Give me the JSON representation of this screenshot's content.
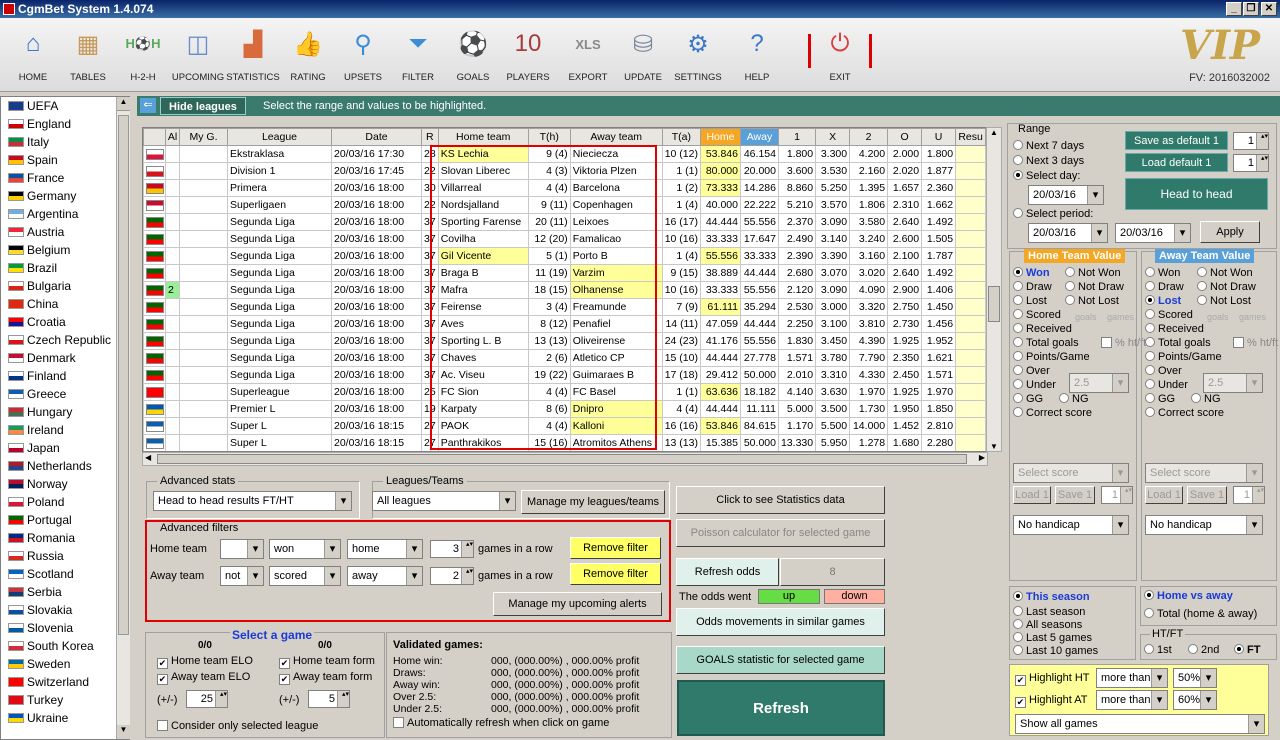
{
  "app": {
    "title": "CgmBet System 1.4.074",
    "vip": "VIP",
    "fv": "FV: 2016032002"
  },
  "toolbar": [
    {
      "label": "HOME",
      "icon": "house-icon",
      "glyph": "⌂",
      "color": "#3c78c8"
    },
    {
      "label": "TABLES",
      "icon": "table-icon",
      "glyph": "▦",
      "color": "#c89a5a"
    },
    {
      "label": "H-2-H",
      "icon": "h2h-icon",
      "glyph": "H⚽H",
      "color": "#5aa85a"
    },
    {
      "label": "UPCOMING",
      "icon": "calendar-icon",
      "glyph": "◫",
      "color": "#6a8cc8"
    },
    {
      "label": "STATISTICS",
      "icon": "chart-icon",
      "glyph": "▟",
      "color": "#d86a3c"
    },
    {
      "label": "RATING",
      "icon": "thumbs-up-icon",
      "glyph": "👍",
      "color": "#3ca83c"
    },
    {
      "label": "UPSETS",
      "icon": "magnifier-icon",
      "glyph": "⚲",
      "color": "#3c8cd8"
    },
    {
      "label": "FILTER",
      "icon": "filter-icon",
      "glyph": "⏷",
      "color": "#3c8cd8"
    },
    {
      "label": "GOALS",
      "icon": "ball-icon",
      "glyph": "⚽",
      "color": "#555555"
    },
    {
      "label": "PLAYERS",
      "icon": "jersey-icon",
      "glyph": "10",
      "color": "#a83c3c"
    },
    {
      "label": "EXPORT",
      "icon": "xls-icon",
      "glyph": "XLS",
      "color": "#888888"
    },
    {
      "label": "UPDATE",
      "icon": "database-icon",
      "glyph": "⛁",
      "color": "#7a8a9a"
    },
    {
      "label": "SETTINGS",
      "icon": "gears-icon",
      "glyph": "⚙",
      "color": "#3c78c8"
    },
    {
      "label": "HELP",
      "icon": "help-icon",
      "glyph": "?",
      "color": "#3c78c8"
    },
    {
      "label": "EXIT",
      "icon": "power-icon",
      "glyph": "⏻",
      "color": "#d83c3c"
    }
  ],
  "countries": [
    {
      "name": "UEFA",
      "c1": "#1a3a8a",
      "c2": "#1a3a8a"
    },
    {
      "name": "England",
      "c1": "#ffffff",
      "c2": "#cc0000"
    },
    {
      "name": "Italy",
      "c1": "#009246",
      "c2": "#ce2b37"
    },
    {
      "name": "Spain",
      "c1": "#c60b1e",
      "c2": "#ffc400"
    },
    {
      "name": "France",
      "c1": "#0055a4",
      "c2": "#ef4135"
    },
    {
      "name": "Germany",
      "c1": "#000000",
      "c2": "#ffce00"
    },
    {
      "name": "Argentina",
      "c1": "#74acdf",
      "c2": "#ffffff"
    },
    {
      "name": "Austria",
      "c1": "#ed2939",
      "c2": "#ffffff"
    },
    {
      "name": "Belgium",
      "c1": "#000000",
      "c2": "#fdda24"
    },
    {
      "name": "Brazil",
      "c1": "#009c3b",
      "c2": "#ffdf00"
    },
    {
      "name": "Bulgaria",
      "c1": "#ffffff",
      "c2": "#d62612"
    },
    {
      "name": "China",
      "c1": "#de2910",
      "c2": "#de2910"
    },
    {
      "name": "Croatia",
      "c1": "#ff0000",
      "c2": "#171796"
    },
    {
      "name": "Czech Republic",
      "c1": "#ffffff",
      "c2": "#d7141a"
    },
    {
      "name": "Denmark",
      "c1": "#c60c30",
      "c2": "#ffffff"
    },
    {
      "name": "Finland",
      "c1": "#ffffff",
      "c2": "#003580"
    },
    {
      "name": "Greece",
      "c1": "#0d5eaf",
      "c2": "#ffffff"
    },
    {
      "name": "Hungary",
      "c1": "#ce2939",
      "c2": "#477050"
    },
    {
      "name": "Ireland",
      "c1": "#169b62",
      "c2": "#ff883e"
    },
    {
      "name": "Japan",
      "c1": "#ffffff",
      "c2": "#bc002d"
    },
    {
      "name": "Netherlands",
      "c1": "#ae1c28",
      "c2": "#21468b"
    },
    {
      "name": "Norway",
      "c1": "#ba0c2f",
      "c2": "#00205b"
    },
    {
      "name": "Poland",
      "c1": "#ffffff",
      "c2": "#dc143c"
    },
    {
      "name": "Portugal",
      "c1": "#006600",
      "c2": "#ff0000"
    },
    {
      "name": "Romania",
      "c1": "#002b7f",
      "c2": "#ce1126"
    },
    {
      "name": "Russia",
      "c1": "#ffffff",
      "c2": "#d52b1e"
    },
    {
      "name": "Scotland",
      "c1": "#0065bd",
      "c2": "#ffffff"
    },
    {
      "name": "Serbia",
      "c1": "#c6363c",
      "c2": "#0c4076"
    },
    {
      "name": "Slovakia",
      "c1": "#ffffff",
      "c2": "#0b4ea2"
    },
    {
      "name": "Slovenia",
      "c1": "#ffffff",
      "c2": "#005da4"
    },
    {
      "name": "South Korea",
      "c1": "#ffffff",
      "c2": "#cd2e3a"
    },
    {
      "name": "Sweden",
      "c1": "#006aa7",
      "c2": "#fecc00"
    },
    {
      "name": "Switzerland",
      "c1": "#ff0000",
      "c2": "#ff0000"
    },
    {
      "name": "Turkey",
      "c1": "#e30a17",
      "c2": "#e30a17"
    },
    {
      "name": "Ukraine",
      "c1": "#0057b7",
      "c2": "#ffd700"
    }
  ],
  "hide_leagues": {
    "button": "Hide leagues",
    "hint": "Select the range and values to be highlighted."
  },
  "grid": {
    "columns": [
      "Al",
      "My G.",
      "League",
      "Date",
      "R",
      "Home team",
      "T(h)",
      "Away team",
      "T(a)",
      "Home",
      "Away",
      "1",
      "X",
      "2",
      "O",
      "U",
      "Resu"
    ],
    "rows": [
      {
        "f1": "#ffffff",
        "f2": "#dc143c",
        "al": "",
        "league": "Ekstraklasa",
        "date": "20/03/16 17:30",
        "r": "28",
        "home": "KS Lechia",
        "hy": true,
        "th": "9 (4)",
        "away": "Nieciecza",
        "ay": false,
        "ta": "10 (12)",
        "hv": "53.846",
        "hvy": true,
        "av": "46.154",
        "o1": "1.800",
        "ox": "3.300",
        "o2": "4.200",
        "oo": "2.000",
        "ou": "1.800"
      },
      {
        "f1": "#ffffff",
        "f2": "#d7141a",
        "al": "",
        "league": "Division 1",
        "date": "20/03/16 17:45",
        "r": "22",
        "home": "Slovan Liberec",
        "hy": false,
        "th": "4 (3)",
        "away": "Viktoria Plzen",
        "ay": false,
        "ta": "1 (1)",
        "hv": "80.000",
        "hvy": true,
        "av": "20.000",
        "o1": "3.600",
        "ox": "3.530",
        "o2": "2.160",
        "oo": "2.020",
        "ou": "1.877"
      },
      {
        "f1": "#c60b1e",
        "f2": "#ffc400",
        "al": "",
        "league": "Primera",
        "date": "20/03/16 18:00",
        "r": "30",
        "home": "Villarreal",
        "hy": false,
        "th": "4 (4)",
        "away": "Barcelona",
        "ay": false,
        "ta": "1 (2)",
        "hv": "73.333",
        "hvy": true,
        "av": "14.286",
        "o1": "8.860",
        "ox": "5.250",
        "o2": "1.395",
        "oo": "1.657",
        "ou": "2.360"
      },
      {
        "f1": "#c60c30",
        "f2": "#ffffff",
        "al": "",
        "league": "Superligaen",
        "date": "20/03/16 18:00",
        "r": "22",
        "home": "Nordsjalland",
        "hy": false,
        "th": "9 (11)",
        "away": "Copenhagen",
        "ay": false,
        "ta": "1 (4)",
        "hv": "40.000",
        "hvy": false,
        "av": "22.222",
        "o1": "5.210",
        "ox": "3.570",
        "o2": "1.806",
        "oo": "2.310",
        "ou": "1.662"
      },
      {
        "f1": "#006600",
        "f2": "#ff0000",
        "al": "",
        "league": "Segunda Liga",
        "date": "20/03/16 18:00",
        "r": "37",
        "home": "Sporting Farense",
        "hy": false,
        "th": "20 (11)",
        "away": "Leixoes",
        "ay": false,
        "ta": "16 (17)",
        "hv": "44.444",
        "hvy": false,
        "av": "55.556",
        "o1": "2.370",
        "ox": "3.090",
        "o2": "3.580",
        "oo": "2.640",
        "ou": "1.492"
      },
      {
        "f1": "#006600",
        "f2": "#ff0000",
        "al": "",
        "league": "Segunda Liga",
        "date": "20/03/16 18:00",
        "r": "37",
        "home": "Covilha",
        "hy": false,
        "th": "12 (20)",
        "away": "Famalicao",
        "ay": false,
        "ta": "10 (16)",
        "hv": "33.333",
        "hvy": false,
        "av": "17.647",
        "o1": "2.490",
        "ox": "3.140",
        "o2": "3.240",
        "oo": "2.600",
        "ou": "1.505"
      },
      {
        "f1": "#006600",
        "f2": "#ff0000",
        "al": "",
        "league": "Segunda Liga",
        "date": "20/03/16 18:00",
        "r": "37",
        "home": "Gil Vicente",
        "hy": true,
        "th": "5 (1)",
        "away": "Porto B",
        "ay": false,
        "ta": "1 (4)",
        "hv": "55.556",
        "hvy": true,
        "av": "33.333",
        "o1": "2.390",
        "ox": "3.390",
        "o2": "3.160",
        "oo": "2.100",
        "ou": "1.787"
      },
      {
        "f1": "#006600",
        "f2": "#ff0000",
        "al": "",
        "league": "Segunda Liga",
        "date": "20/03/16 18:00",
        "r": "37",
        "home": "Braga B",
        "hy": false,
        "th": "11 (19)",
        "away": "Varzim",
        "ay": true,
        "ta": "9 (15)",
        "hv": "38.889",
        "hvy": false,
        "av": "44.444",
        "o1": "2.680",
        "ox": "3.070",
        "o2": "3.020",
        "oo": "2.640",
        "ou": "1.492"
      },
      {
        "f1": "#006600",
        "f2": "#ff0000",
        "al": "2",
        "league": "Segunda Liga",
        "date": "20/03/16 18:00",
        "r": "37",
        "home": "Mafra",
        "hy": false,
        "th": "18 (15)",
        "away": "Olhanense",
        "ay": true,
        "ta": "10 (16)",
        "hv": "33.333",
        "hvy": false,
        "av": "55.556",
        "o1": "2.120",
        "ox": "3.090",
        "o2": "4.090",
        "oo": "2.900",
        "ou": "1.406"
      },
      {
        "f1": "#006600",
        "f2": "#ff0000",
        "al": "",
        "league": "Segunda Liga",
        "date": "20/03/16 18:00",
        "r": "37",
        "home": "Feirense",
        "hy": false,
        "th": "3 (4)",
        "away": "Freamunde",
        "ay": false,
        "ta": "7 (9)",
        "hv": "61.111",
        "hvy": true,
        "av": "35.294",
        "o1": "2.530",
        "ox": "3.000",
        "o2": "3.320",
        "oo": "2.750",
        "ou": "1.450"
      },
      {
        "f1": "#006600",
        "f2": "#ff0000",
        "al": "",
        "league": "Segunda Liga",
        "date": "20/03/16 18:00",
        "r": "37",
        "home": "Aves",
        "hy": false,
        "th": "8 (12)",
        "away": "Penafiel",
        "ay": false,
        "ta": "14 (11)",
        "hv": "47.059",
        "hvy": false,
        "av": "44.444",
        "o1": "2.250",
        "ox": "3.100",
        "o2": "3.810",
        "oo": "2.730",
        "ou": "1.456"
      },
      {
        "f1": "#006600",
        "f2": "#ff0000",
        "al": "",
        "league": "Segunda Liga",
        "date": "20/03/16 18:00",
        "r": "37",
        "home": "Sporting L. B",
        "hy": false,
        "th": "13 (13)",
        "away": "Oliveirense",
        "ay": false,
        "ta": "24 (23)",
        "hv": "41.176",
        "hvy": false,
        "av": "55.556",
        "o1": "1.830",
        "ox": "3.450",
        "o2": "4.390",
        "oo": "1.925",
        "ou": "1.952"
      },
      {
        "f1": "#006600",
        "f2": "#ff0000",
        "al": "",
        "league": "Segunda Liga",
        "date": "20/03/16 18:00",
        "r": "37",
        "home": "Chaves",
        "hy": false,
        "th": "2 (6)",
        "away": "Atletico CP",
        "ay": false,
        "ta": "15 (10)",
        "hv": "44.444",
        "hvy": false,
        "av": "27.778",
        "o1": "1.571",
        "ox": "3.780",
        "o2": "7.790",
        "oo": "2.350",
        "ou": "1.621"
      },
      {
        "f1": "#006600",
        "f2": "#ff0000",
        "al": "",
        "league": "Segunda Liga",
        "date": "20/03/16 18:00",
        "r": "37",
        "home": "Ac. Viseu",
        "hy": false,
        "th": "19 (22)",
        "away": "Guimaraes B",
        "ay": false,
        "ta": "17 (18)",
        "hv": "29.412",
        "hvy": false,
        "av": "50.000",
        "o1": "2.010",
        "ox": "3.310",
        "o2": "4.330",
        "oo": "2.450",
        "ou": "1.571"
      },
      {
        "f1": "#ff0000",
        "f2": "#ff0000",
        "al": "",
        "league": "Superleague",
        "date": "20/03/16 18:00",
        "r": "25",
        "home": "FC Sion",
        "hy": false,
        "th": "4 (4)",
        "away": "FC Basel",
        "ay": false,
        "ta": "1 (1)",
        "hv": "63.636",
        "hvy": true,
        "av": "18.182",
        "o1": "4.140",
        "ox": "3.630",
        "o2": "1.970",
        "oo": "1.925",
        "ou": "1.970"
      },
      {
        "f1": "#0057b7",
        "f2": "#ffd700",
        "al": "",
        "league": "Premier L",
        "date": "20/03/16 18:00",
        "r": "19",
        "home": "Karpaty",
        "hy": false,
        "th": "8 (6)",
        "away": "Dnipro",
        "ay": true,
        "ta": "4 (4)",
        "hv": "44.444",
        "hvy": false,
        "av": "11.111",
        "o1": "5.000",
        "ox": "3.500",
        "o2": "1.730",
        "oo": "1.950",
        "ou": "1.850"
      },
      {
        "f1": "#0d5eaf",
        "f2": "#ffffff",
        "al": "",
        "league": "Super L",
        "date": "20/03/16 18:15",
        "r": "27",
        "home": "PAOK",
        "hy": false,
        "th": "4 (4)",
        "away": "Kalloni",
        "ay": true,
        "ta": "16 (16)",
        "hv": "53.846",
        "hvy": true,
        "av": "84.615",
        "o1": "1.170",
        "ox": "5.500",
        "o2": "14.000",
        "oo": "1.452",
        "ou": "2.810"
      },
      {
        "f1": "#0d5eaf",
        "f2": "#ffffff",
        "al": "",
        "league": "Super L",
        "date": "20/03/16 18:15",
        "r": "27",
        "home": "Panthrakikos",
        "hy": false,
        "th": "15 (16)",
        "away": "Atromitos Athens",
        "ay": false,
        "ta": "13 (13)",
        "hv": "15.385",
        "hvy": false,
        "av": "50.000",
        "o1": "13.330",
        "ox": "5.950",
        "o2": "1.278",
        "oo": "1.680",
        "ou": "2.280"
      }
    ]
  },
  "advanced_stats": {
    "title": "Advanced stats",
    "value": "Head to head results FT/HT"
  },
  "leagues_teams": {
    "title": "Leagues/Teams",
    "value": "All leagues",
    "manage": "Manage my leagues/teams"
  },
  "advanced_filters": {
    "title": "Advanced filters",
    "home": {
      "label": "Home team",
      "mod": "",
      "cond": "won",
      "venue": "home",
      "n": "3",
      "suffix": "games in a row",
      "remove": "Remove filter"
    },
    "away": {
      "label": "Away team",
      "mod": "not",
      "cond": "scored",
      "venue": "away",
      "n": "2",
      "suffix": "games in a row",
      "remove": "Remove filter"
    },
    "alerts": "Manage my upcoming alerts"
  },
  "select_game": {
    "title": "Select a game",
    "home_score": "0/0",
    "away_score": "0/0",
    "home_elo": "Home team ELO",
    "away_elo": "Away team ELO",
    "home_form": "Home team form",
    "away_form": "Away team form",
    "pm1": "(+/-)",
    "v1": "25",
    "pm2": "(+/-)",
    "v2": "5",
    "consider": "Consider only selected league"
  },
  "validated": {
    "title": "Validated games:",
    "rows": [
      {
        "k": "Home win:",
        "v": "000, (000.00%) , 000.00% profit"
      },
      {
        "k": "Draws:",
        "v": "000, (000.00%) , 000.00% profit"
      },
      {
        "k": "Away win:",
        "v": "000, (000.00%) , 000.00% profit"
      },
      {
        "k": "Over 2.5:",
        "v": "000, (000.00%) , 000.00% profit"
      },
      {
        "k": "Under 2.5:",
        "v": "000, (000.00%) , 000.00% profit"
      }
    ],
    "auto": "Automatically refresh when click on game"
  },
  "mid_buttons": {
    "stats": "Click to see Statistics data",
    "poisson": "Poisson calculator for selected game",
    "refresh_odds": "Refresh odds",
    "refresh_odds_n": "8",
    "odds_went": "The odds went",
    "up": "up",
    "down": "down",
    "similar": "Odds movements in similar games",
    "goals": "GOALS statistic for selected game",
    "refresh": "Refresh"
  },
  "range": {
    "title": "Range",
    "save_default": "Save as default 1",
    "load_default": "Load default 1",
    "sv1": "1",
    "sv2": "1",
    "next7": "Next 7 days",
    "next3": "Next 3 days",
    "select_day": "Select day:",
    "day": "20/03/16",
    "select_period": "Select period:",
    "p_from": "20/03/16",
    "p_to": "20/03/16",
    "apply": "Apply",
    "h2h": "Head to head"
  },
  "home_value": {
    "title": "Home Team Value",
    "won": "Won",
    "not_won": "Not Won",
    "draw": "Draw",
    "not_draw": "Not Draw",
    "lost": "Lost",
    "not_lost": "Not Lost",
    "scored": "Scored",
    "received": "Received",
    "goals": "goals",
    "games": "games",
    "total_goals": "Total goals",
    "pct": "% ht/ft",
    "ppg": "Points/Game",
    "over": "Over",
    "under": "Under",
    "uval": "2.5",
    "gg": "GG",
    "ng": "NG",
    "correct": "Correct score",
    "select_score": "Select score",
    "load": "Load 1",
    "save": "Save 1",
    "n": "1",
    "handicap": "No handicap"
  },
  "away_value": {
    "title": "Away Team Value",
    "won": "Won",
    "not_won": "Not Won",
    "draw": "Draw",
    "not_draw": "Not Draw",
    "lost": "Lost",
    "not_lost": "Not Lost",
    "scored": "Scored",
    "received": "Received",
    "goals": "goals",
    "games": "games",
    "total_goals": "Total goals",
    "pct": "% ht/ft",
    "ppg": "Points/Game",
    "over": "Over",
    "under": "Under",
    "uval": "2.5",
    "gg": "GG",
    "ng": "NG",
    "correct": "Correct score",
    "select_score": "Select score",
    "load": "Load 1",
    "save": "Save 1",
    "n": "1",
    "handicap": "No handicap"
  },
  "season": {
    "this": "This season",
    "last": "Last season",
    "all": "All seasons",
    "last5": "Last 5 games",
    "last10": "Last 10 games"
  },
  "venue": {
    "hva": "Home vs away",
    "total": "Total (home & away)"
  },
  "htft": {
    "title": "HT/FT",
    "first": "1st",
    "second": "2nd",
    "ft": "FT"
  },
  "highlight": {
    "ht": "Highlight HT",
    "ht_cmp": "more than",
    "ht_pct": "50%",
    "at": "Highlight AT",
    "at_cmp": "more than",
    "at_pct": "60%",
    "show": "Show all games"
  }
}
